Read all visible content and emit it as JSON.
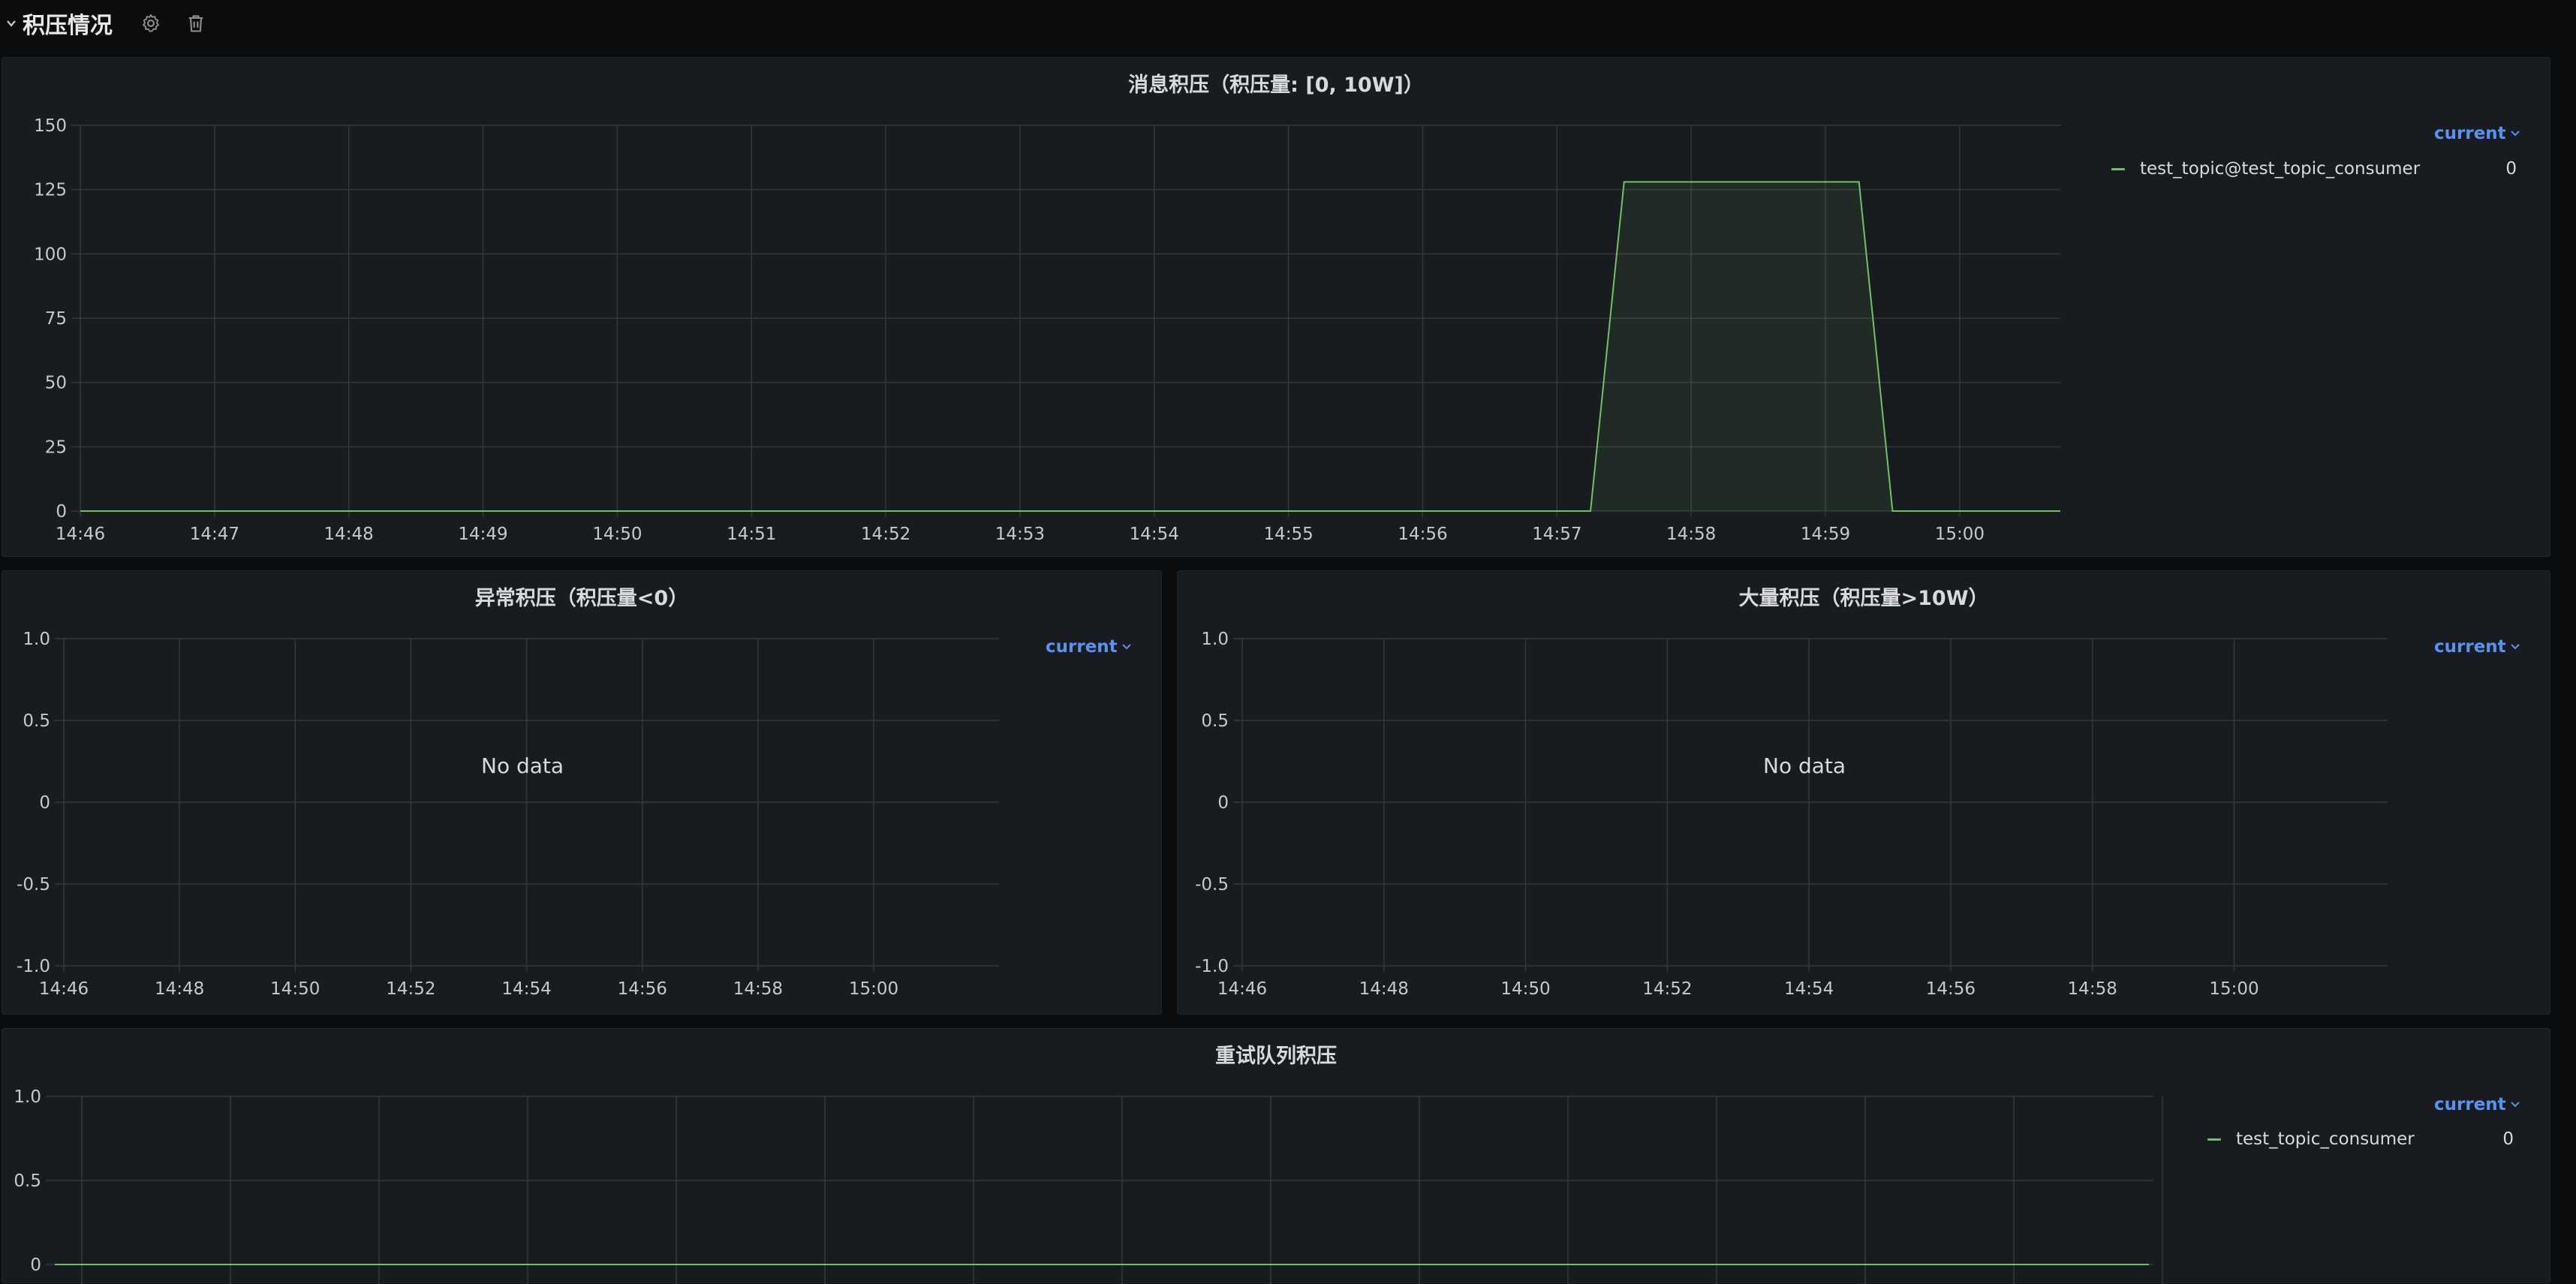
{
  "row": {
    "title": "积压情况"
  },
  "icons": {
    "collapse": "chevron-down-icon",
    "settings": "gear-icon",
    "delete": "trash-icon"
  },
  "colors": {
    "series": "#73bf69",
    "grid": "#34373c",
    "legend_header": "#5794f2"
  },
  "panels": {
    "backlog": {
      "title": "消息积压（积压量: [0, 10W]）",
      "legend_header": "current",
      "legend": [
        {
          "name": "test_topic@test_topic_consumer",
          "value": "0"
        }
      ]
    },
    "abnormal": {
      "title": "异常积压（积压量<0）",
      "legend_header": "current",
      "no_data": "No data"
    },
    "large": {
      "title": "大量积压（积压量>10W）",
      "legend_header": "current",
      "no_data": "No data"
    },
    "retry": {
      "title": "重试队列积压",
      "legend_header": "current",
      "legend": [
        {
          "name": "test_topic_consumer",
          "value": "0"
        }
      ]
    }
  },
  "chart_data": [
    {
      "id": "backlog",
      "type": "area",
      "title": "消息积压（积压量: [0, 10W]）",
      "xlabel": "",
      "ylabel": "",
      "x_ticks": [
        "14:46",
        "14:47",
        "14:48",
        "14:49",
        "14:50",
        "14:51",
        "14:52",
        "14:53",
        "14:54",
        "14:55",
        "14:56",
        "14:57",
        "14:58",
        "14:59",
        "15:00"
      ],
      "y_ticks": [
        "0",
        "25",
        "50",
        "75",
        "100",
        "125",
        "150"
      ],
      "ylim": [
        0,
        150
      ],
      "xlim": [
        "14:46",
        "15:00:45"
      ],
      "grid": true,
      "legend": "right",
      "series": [
        {
          "name": "test_topic@test_topic_consumer",
          "x": [
            "14:46",
            "14:57:15",
            "14:57:30",
            "14:59:15",
            "14:59:30",
            "15:00:45"
          ],
          "y": [
            0,
            0,
            128,
            128,
            0,
            0
          ]
        }
      ]
    },
    {
      "id": "abnormal",
      "type": "line",
      "title": "异常积压（积压量<0）",
      "x_ticks": [
        "14:46",
        "14:48",
        "14:50",
        "14:52",
        "14:54",
        "14:56",
        "14:58",
        "15:00"
      ],
      "y_ticks": [
        "1.0",
        "0.5",
        "0",
        "-0.5",
        "-1.0"
      ],
      "ylim": [
        -1,
        1
      ],
      "grid": true,
      "series": []
    },
    {
      "id": "large",
      "type": "line",
      "title": "大量积压（积压量>10W）",
      "x_ticks": [
        "14:46",
        "14:48",
        "14:50",
        "14:52",
        "14:54",
        "14:56",
        "14:58",
        "15:00"
      ],
      "y_ticks": [
        "1.0",
        "0.5",
        "0",
        "-0.5",
        "-1.0"
      ],
      "ylim": [
        -1,
        1
      ],
      "grid": true,
      "series": []
    },
    {
      "id": "retry",
      "type": "line",
      "title": "重试队列积压",
      "y_ticks": [
        "1.0",
        "0.5",
        "0"
      ],
      "ylim": [
        -1,
        1
      ],
      "grid": true,
      "legend": "right",
      "series": [
        {
          "name": "test_topic_consumer",
          "y_constant": 0
        }
      ]
    }
  ]
}
